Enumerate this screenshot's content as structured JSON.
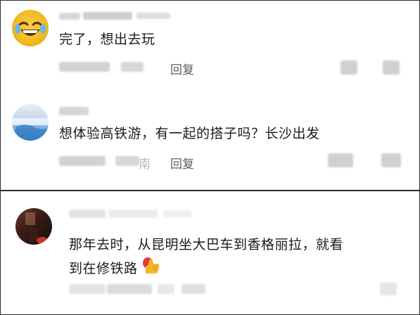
{
  "comments": [
    {
      "text": "完了，想出去玩",
      "reply_label": "回复"
    },
    {
      "text": "想体验高铁游，有一起的搭子吗？长沙出发",
      "region": "南",
      "reply_label": "回复"
    },
    {
      "text_line1": "那年去时，从昆明坐大巴车到香格丽拉，就看",
      "text_line2": "到在修铁路"
    }
  ],
  "icons": {
    "thumbs_up_emoji": "thumbs-up"
  },
  "colors": {
    "text": "#1b1b1b",
    "muted": "#5f5f5f",
    "divider": "#2b2b2b"
  }
}
